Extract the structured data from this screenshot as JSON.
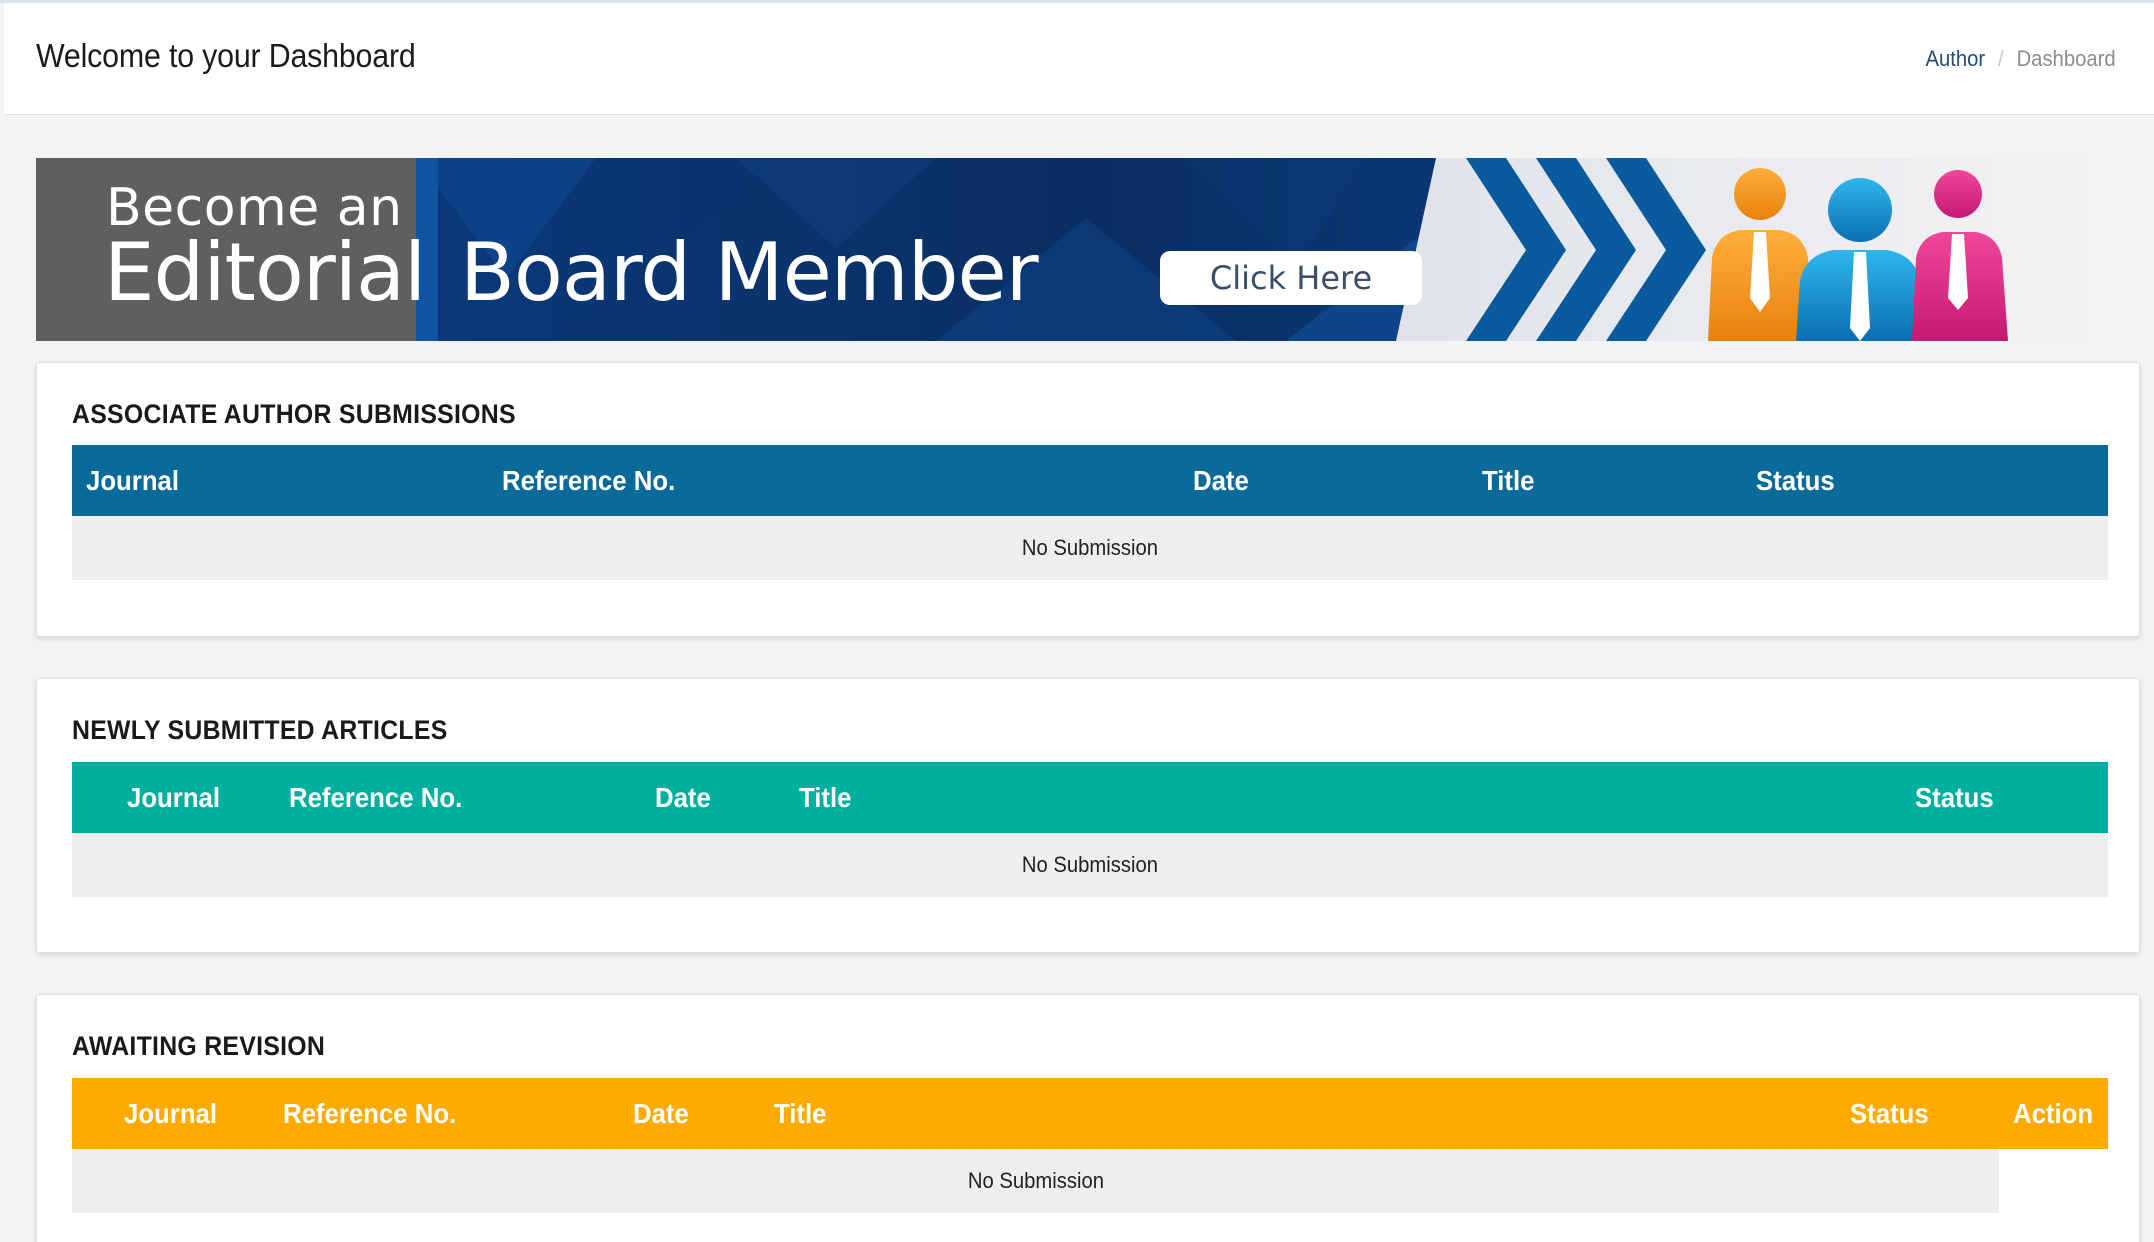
{
  "header": {
    "title": "Welcome to your Dashboard",
    "breadcrumb": {
      "parent": "Author",
      "separator": "/",
      "current": "Dashboard"
    }
  },
  "banner": {
    "line1": "Become an",
    "line2_a": "Editorial",
    "line2_b": "Board Member",
    "button_label": "Click Here"
  },
  "sections": {
    "associate": {
      "title": "ASSOCIATE AUTHOR SUBMISSIONS",
      "color": "#0a6a9a",
      "columns": [
        "Journal",
        "Reference No.",
        "Date",
        "Title",
        "Status"
      ],
      "empty_text": "No Submission"
    },
    "newly": {
      "title": "NEWLY SUBMITTED ARTICLES",
      "color": "#00b09e",
      "columns": [
        "Journal",
        "Reference No.",
        "Date",
        "Title",
        "Status"
      ],
      "empty_text": "No Submission"
    },
    "awaiting": {
      "title": "AWAITING REVISION",
      "color": "#ffaa00",
      "columns": [
        "Journal",
        "Reference No.",
        "Date",
        "Title",
        "Status",
        "Action"
      ],
      "empty_text": "No Submission"
    }
  },
  "icons": [
    "chevron-right-icon",
    "person-orange-icon",
    "person-blue-icon",
    "person-pink-icon"
  ]
}
